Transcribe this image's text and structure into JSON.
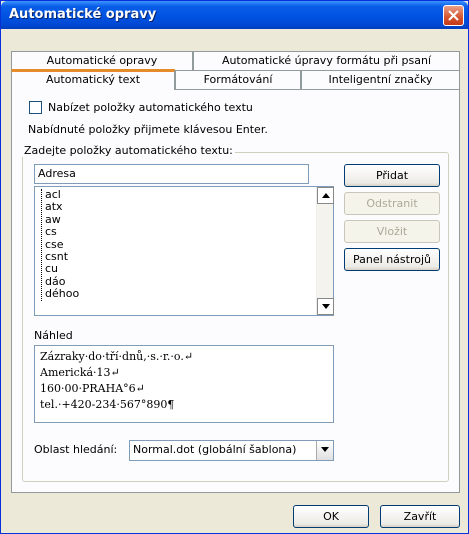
{
  "window": {
    "title": "Automatické opravy"
  },
  "tabs": {
    "back": [
      "Automatické opravy",
      "Automatické úpravy formátu při psaní"
    ],
    "front": [
      "Automatický text",
      "Formátování",
      "Inteligentní značky"
    ]
  },
  "panel": {
    "checkbox_label": "Nabízet položky automatického textu",
    "checkbox_checked": false,
    "hint": "Nabídnuté položky přijmete klávesou Enter.",
    "group_label": "Zadejte položky automatického textu:",
    "entry_value": "Adresa",
    "list_items": [
      "acl",
      "atx",
      "aw",
      "cs",
      "cse",
      "csnt",
      "cu",
      "dáo",
      "déhoo"
    ],
    "buttons": {
      "add": "Přidat",
      "remove": "Odstranit",
      "insert": "Vložit",
      "toolbar": "Panel nástrojů"
    },
    "preview_label": "Náhled",
    "preview_lines": [
      "Zázraky·do·tří·dnů,·s.·r.·o.↵",
      "Americká·13↵",
      "160·00·PRAHA°6↵",
      "tel.·+420-234·567°890¶"
    ],
    "search_label": "Oblast hledání:",
    "search_value": "Normal.dot (globální šablona)"
  },
  "footer": {
    "ok": "OK",
    "close": "Zavřít"
  }
}
